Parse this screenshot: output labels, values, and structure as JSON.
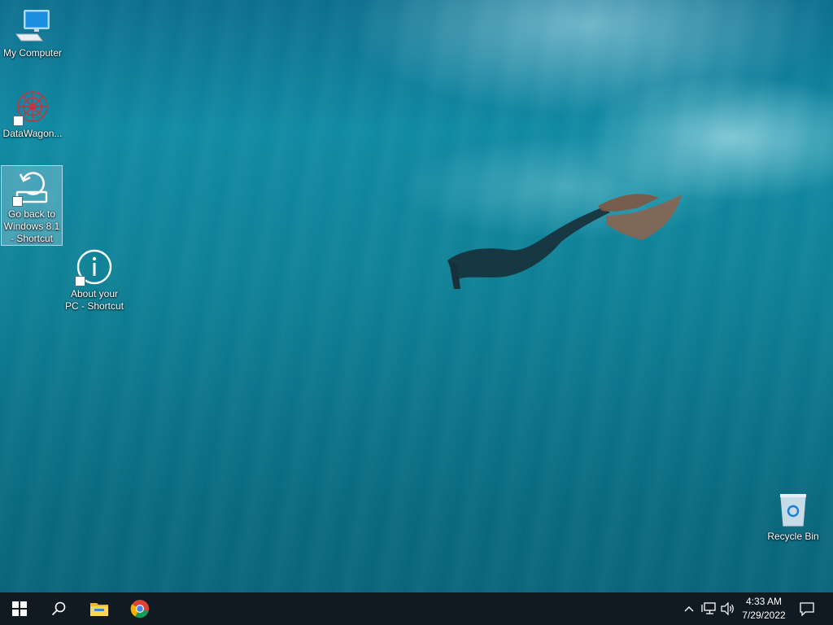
{
  "desktop": {
    "icons": [
      {
        "label": "My Computer",
        "icon": "monitor-icon"
      },
      {
        "label": "DataWagon...",
        "icon": "datawagon-logo-icon"
      },
      {
        "label": "Go back to Windows 8.1 - Shortcut",
        "icon": "restore-icon"
      },
      {
        "label": "About your PC - Shortcut",
        "icon": "info-icon"
      },
      {
        "label": "Recycle Bin",
        "icon": "recycle-bin-icon"
      }
    ]
  },
  "taskbar": {
    "start": "windows-logo-icon",
    "search": "search-icon",
    "file_explorer": "folder-icon",
    "chrome": "chrome-icon",
    "tray": [
      "chevron-up-icon",
      "network-icon",
      "volume-icon"
    ],
    "clock": {
      "time": "4:33 AM",
      "date": "7/29/2022"
    },
    "notifications": "action-center-icon"
  }
}
